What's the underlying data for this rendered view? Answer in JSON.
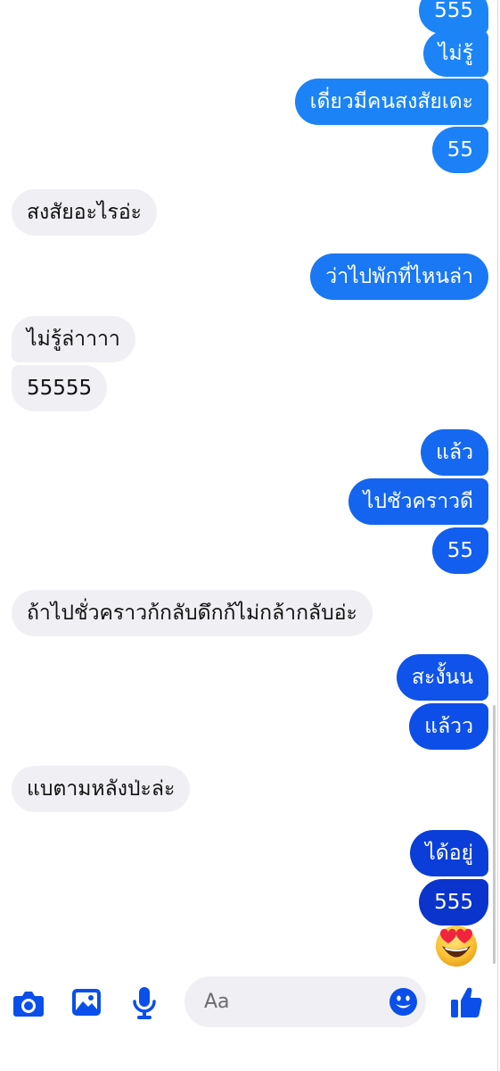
{
  "colors": {
    "accent": "#0a4fea",
    "outgoing_top": "#1a78f7",
    "outgoing_bottom": "#0a2fc4",
    "incoming_bg": "#f0f0f4"
  },
  "messages": [
    {
      "side": "out",
      "text": "555",
      "color": "#1c85f6"
    },
    {
      "side": "out",
      "text": "ไม่รู้",
      "color": "#1c84f6"
    },
    {
      "side": "out",
      "text": "เดี่ยวมีคนสงสัยเดะ",
      "color": "#1c83f6"
    },
    {
      "side": "out",
      "text": "55",
      "color": "#1c81f6"
    },
    {
      "side": "in",
      "text": "สงสัยอะไรอ่ะ"
    },
    {
      "side": "out",
      "text": "ว่าไปพักที่ไหนล่า",
      "color": "#1a78f4"
    },
    {
      "side": "in",
      "text": "ไม่รู้ล่าาาา"
    },
    {
      "side": "in",
      "text": "55555"
    },
    {
      "side": "out",
      "text": "แล้ว",
      "color": "#1569f0"
    },
    {
      "side": "out",
      "text": "ไปชัวคราวดี",
      "color": "#1464ef"
    },
    {
      "side": "out",
      "text": "55",
      "color": "#125eee"
    },
    {
      "side": "in",
      "text": "ถ้าไปชั่วคราวก้กลับดึกก้ไม่กล้ากลับอ่ะ"
    },
    {
      "side": "out",
      "text": "สะงั้นน",
      "color": "#0f53ea"
    },
    {
      "side": "out",
      "text": "แล้วว",
      "color": "#0e4ee8"
    },
    {
      "side": "in",
      "text": "แบตามหลังป่ะล่ะ"
    },
    {
      "side": "out",
      "text": "ได้อยู่",
      "color": "#0b3ed8"
    },
    {
      "side": "out",
      "text": "555",
      "color": "#0a34cc"
    }
  ],
  "reaction": {
    "icon": "heart-eyes-emoji-icon"
  },
  "composer": {
    "placeholder": "Aa",
    "icons": [
      "camera-icon",
      "gallery-icon",
      "microphone-icon",
      "emoji-icon",
      "thumbs-up-icon"
    ]
  }
}
